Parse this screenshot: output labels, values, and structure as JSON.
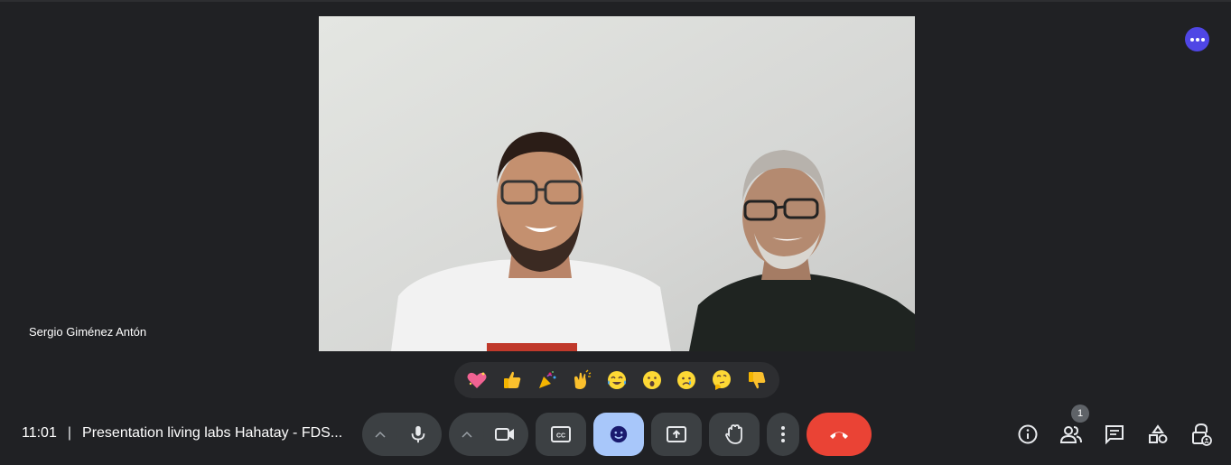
{
  "participant": {
    "name": "Sergio Giménez Antón"
  },
  "meeting": {
    "time": "11:01",
    "separator": "|",
    "title": "Presentation living labs Hahatay - FDS..."
  },
  "reactions": [
    {
      "name": "sparkling-heart",
      "glyph": "💖"
    },
    {
      "name": "thumbs-up",
      "glyph": "👍"
    },
    {
      "name": "party-popper",
      "glyph": "🎉"
    },
    {
      "name": "clapping-hands",
      "glyph": "👏"
    },
    {
      "name": "tears-of-joy",
      "glyph": "😂"
    },
    {
      "name": "surprised",
      "glyph": "😮"
    },
    {
      "name": "crying",
      "glyph": "😢"
    },
    {
      "name": "thinking",
      "glyph": "🤔"
    },
    {
      "name": "thumbs-down",
      "glyph": "👎"
    }
  ],
  "people": {
    "count": "1"
  },
  "colors": {
    "background": "#202124",
    "control": "#3c4043",
    "active": "#a8c7fa",
    "hangup": "#ea4335",
    "fab": "#4f46e5"
  }
}
